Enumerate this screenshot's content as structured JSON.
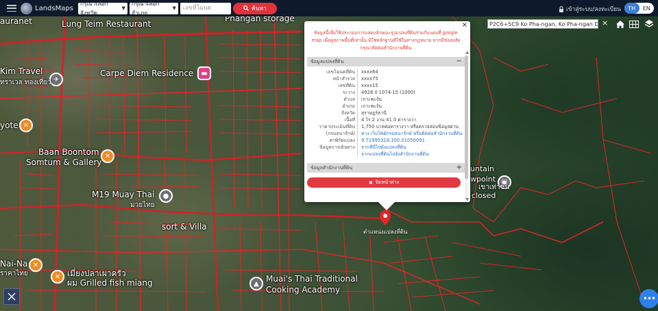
{
  "header": {
    "brand": "LandsMaps",
    "province_select": "กรุณาเลือกจังหวัด",
    "amphoe_select": "กรุณาเลือกอำเภอ",
    "parcel_placeholder": "เลขที่โฉนด",
    "search_label": "ค้นหา",
    "login_label": "เข้าสู่ระบบ/ลงทะเบียน",
    "lang_th": "TH",
    "lang_en": "EN"
  },
  "map": {
    "labels": {
      "lung_teim": "Lung Teim Restaurant",
      "phangan_storage": "Phangan storage",
      "auranet": "auranet",
      "kim_travel": "Kim Travel",
      "kim_travel_thai": "ทราเวล ทองเที่ยว",
      "carpe_diem": "Carpe Diem Residence",
      "yote": "yote",
      "baan_boontom": "Baan Boontom",
      "somtum_gallery": "Somtum & Gallery",
      "m19_muay_thai": "M19 Muay Thai",
      "muay_thai_thai": "มวยไทย",
      "resort_villa": "sort & Villa",
      "nai_na": "Nai-Na",
      "nai_na_thai": "ราคาไทย",
      "grilled_fish_thai": "เมี่ยงปลาเผาครัว",
      "grilled_fish": "ผม Grilled fish miang",
      "muais_thai": "Muai's Thai Traditional",
      "cooking_academy": "Cooking Academy",
      "mountain": "untain",
      "viewpoint": "wpoint",
      "closed": "closed",
      "viewpoint_thai": "เขาเท่าชน"
    },
    "marker_label": "ตำแหน่งแปลงที่ดิน"
  },
  "popup": {
    "close_x": "×",
    "disclaimer": "ข้อมูลนี้เพื่อใช้ประกอบการแสดงลักษณะรูปแปลงที่ดินร่วมกับแผนที่ google map เพื่อดูสภาพพื้นที่เท่านั้น มิใช่หลักฐานที่ใช้ในทางกฎหมาย หากมีข้อสงสัย กรุณาติดต่อสำนักงานที่ดิน",
    "section_parcel": "ข้อมูลแปลงที่ดิน",
    "section_parcel_toggle": "−",
    "section_office": "ข้อมูลสำนักงานที่ดิน",
    "section_office_toggle": "+",
    "rows": [
      {
        "k": "เลขโฉนดที่ดิน",
        "v": "xxxx64"
      },
      {
        "k": "หน้าสำรวจ",
        "v": "xxxx75"
      },
      {
        "k": "เลขที่ดิน",
        "v": "xxxx15"
      },
      {
        "k": "ระวาง",
        "v": "4928 II 1074-15 (1000)"
      },
      {
        "k": "ตำบล",
        "v": "เกาะพะงัน"
      },
      {
        "k": "อำเภอ",
        "v": "เกาะพะงัน"
      },
      {
        "k": "จังหวัด",
        "v": "สุราษฎร์ธานี"
      },
      {
        "k": "เนื้อที่",
        "v": "4 ไร่ 2 งาน 41.0 ตารางวา"
      },
      {
        "k": "ราคาประเมินที่ดิน",
        "v": "1,750 บาทต่อตารางวา หรือตรวจสอบข้อมูลผ่าน"
      },
      {
        "k": "(กรมธนารักษ์)",
        "v": "ทาง เว็บไซต์กรมธนารักษ์ หรือติดต่อสำนักงานที่ดิน"
      },
      {
        "k": "ค่าพิกัดแปลง",
        "v": "9.71995318,100.01050091"
      },
      {
        "k": "ข้อมูลการเดินทาง",
        "v": "จากที่นี่ไปยังแปลงที่ดิน"
      },
      {
        "k": "",
        "v": "จากแปลงที่ดินไปยังสำนักงานที่ดิน"
      }
    ],
    "close_button": "ปิดหน้าต่าง"
  },
  "controls": {
    "coord_value": "P2C6+5C9 Ko Pha-ngan, Ko Pha-ngan Dis",
    "coord_clear": "×",
    "fab_label": "•••"
  },
  "colors": {
    "parcel_line": "#e8232b",
    "accent_blue": "#3b7dd8",
    "button_red": "#e2323b"
  }
}
